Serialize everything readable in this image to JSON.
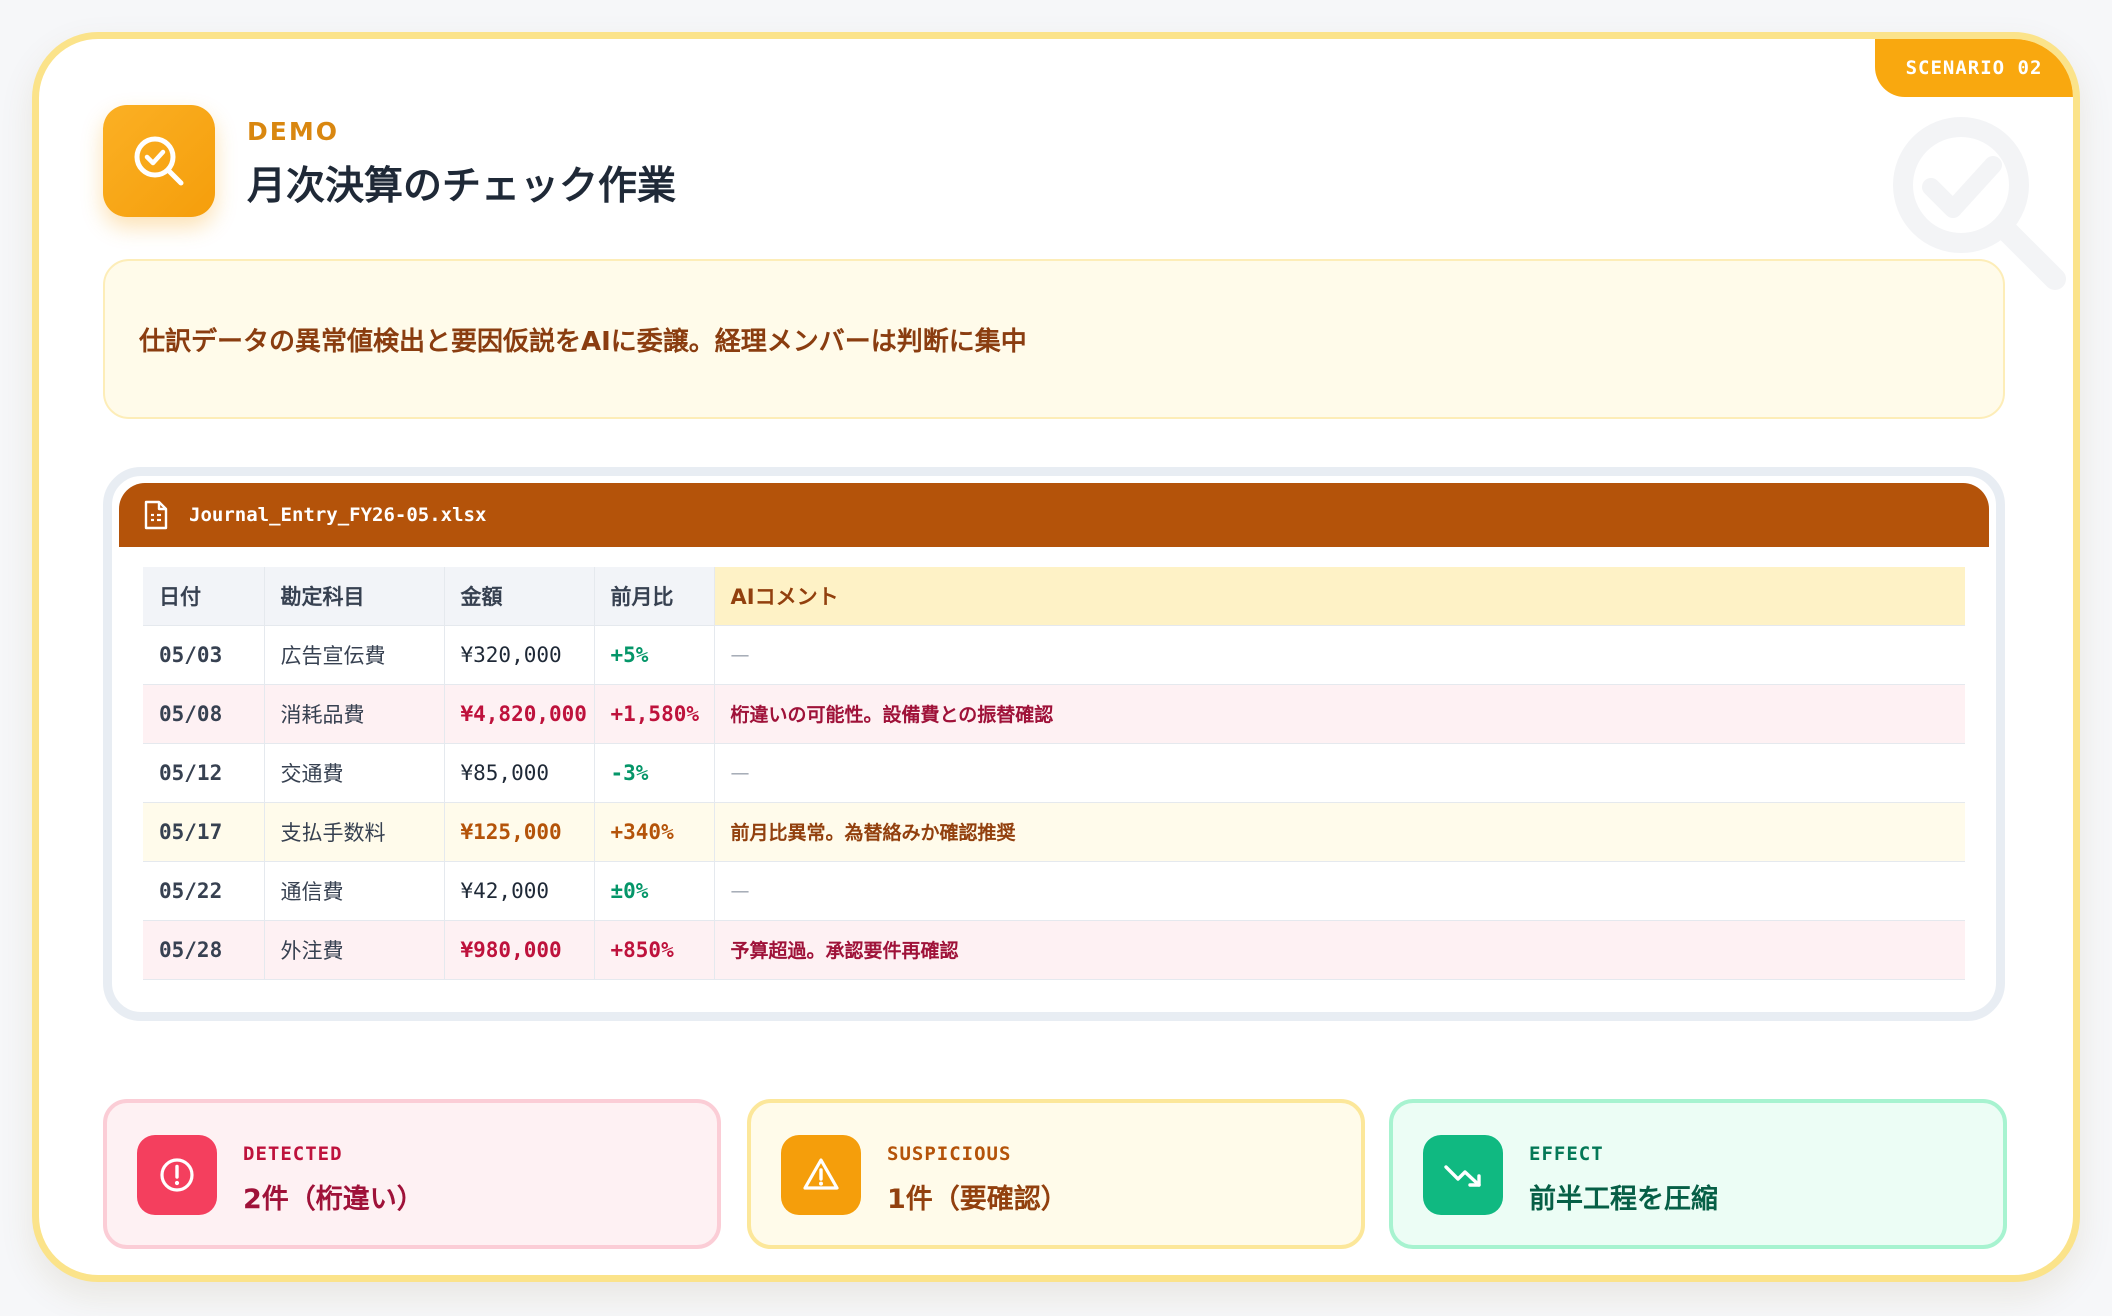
{
  "badge": "SCENARIO 02",
  "header": {
    "eyebrow": "DEMO",
    "title": "月次決算のチェック作業",
    "icon": "search-check-icon"
  },
  "summary": "仕訳データの異常値検出と要因仮説をAIに委譲。経理メンバーは判断に集中",
  "sheet": {
    "filename": "Journal_Entry_FY26-05.xlsx",
    "icon": "spreadsheet-file-icon",
    "columns": [
      "日付",
      "勘定科目",
      "金額",
      "前月比",
      "AIコメント"
    ],
    "rows": [
      {
        "date": "05/03",
        "account": "広告宣伝費",
        "amount": "¥320,000",
        "change": "+5%",
        "comment": "—",
        "status": "normal"
      },
      {
        "date": "05/08",
        "account": "消耗品費",
        "amount": "¥4,820,000",
        "change": "+1,580%",
        "comment": "桁違いの可能性。設備費との振替確認",
        "status": "error"
      },
      {
        "date": "05/12",
        "account": "交通費",
        "amount": "¥85,000",
        "change": "-3%",
        "comment": "—",
        "status": "normal"
      },
      {
        "date": "05/17",
        "account": "支払手数料",
        "amount": "¥125,000",
        "change": "+340%",
        "comment": "前月比異常。為替絡みか確認推奨",
        "status": "warning"
      },
      {
        "date": "05/22",
        "account": "通信費",
        "amount": "¥42,000",
        "change": "±0%",
        "comment": "—",
        "status": "normal"
      },
      {
        "date": "05/28",
        "account": "外注費",
        "amount": "¥980,000",
        "change": "+850%",
        "comment": "予算超過。承認要件再確認",
        "status": "error"
      }
    ]
  },
  "stats": [
    {
      "label": "DETECTED",
      "value": "2件（桁違い）",
      "icon": "alert-circle-icon"
    },
    {
      "label": "SUSPICIOUS",
      "value": "1件（要確認）",
      "icon": "warning-triangle-icon"
    },
    {
      "label": "EFFECT",
      "value": "前半工程を圧縮",
      "icon": "trending-down-icon"
    }
  ],
  "colors": {
    "accent": "#f59e0b",
    "header_bar": "#b4530a",
    "error": "#be123c",
    "warning": "#b45309",
    "positive": "#059669"
  }
}
